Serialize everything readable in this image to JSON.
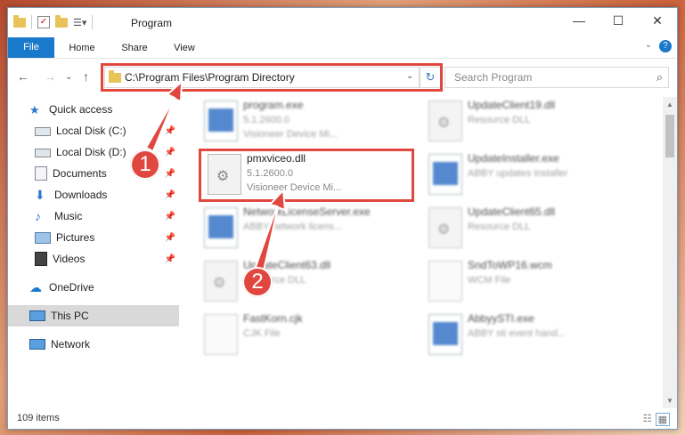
{
  "window": {
    "title": "Program"
  },
  "ribbon": {
    "tabs": [
      "File",
      "Home",
      "Share",
      "View"
    ],
    "help": "?"
  },
  "address": {
    "path": "C:\\Program Files\\Program Directory"
  },
  "search": {
    "placeholder": "Search Program"
  },
  "sidebar": {
    "items": [
      {
        "label": "Quick access"
      },
      {
        "label": "Local Disk (C:)"
      },
      {
        "label": "Local Disk (D:)"
      },
      {
        "label": "Documents"
      },
      {
        "label": "Downloads"
      },
      {
        "label": "Music"
      },
      {
        "label": "Pictures"
      },
      {
        "label": "Videos"
      },
      {
        "label": "OneDrive"
      },
      {
        "label": "This PC"
      },
      {
        "label": "Network"
      }
    ]
  },
  "files": [
    {
      "name": "program.exe",
      "line2": "5.1.2600.0",
      "line3": "Visioneer Device Mi..."
    },
    {
      "name": "UpdateClient19.dll",
      "line2": "Resource DLL",
      "line3": ""
    },
    {
      "name": "pmxviceo.dll",
      "line2": "5.1.2600.0",
      "line3": "Visioneer Device Mi..."
    },
    {
      "name": "UpdateInstaller.exe",
      "line2": "ABBY updates installer",
      "line3": ""
    },
    {
      "name": "NetworkLicenseServer.exe",
      "line2": "ABBY network licens...",
      "line3": ""
    },
    {
      "name": "UpdateClient65.dll",
      "line2": "Resource DLL",
      "line3": ""
    },
    {
      "name": "UpdateClient63.dll",
      "line2": "Resource DLL",
      "line3": ""
    },
    {
      "name": "SndToWP16.wcm",
      "line2": "WCM File",
      "line3": ""
    },
    {
      "name": "FastKorn.cjk",
      "line2": "CJK File",
      "line3": ""
    },
    {
      "name": "AbbyySTI.exe",
      "line2": "ABBY sti event hand...",
      "line3": ""
    }
  ],
  "status": {
    "items": "109 items"
  },
  "callouts": {
    "one": "1",
    "two": "2"
  },
  "colors": {
    "accent": "#1979ca",
    "highlight": "#e0473f"
  }
}
